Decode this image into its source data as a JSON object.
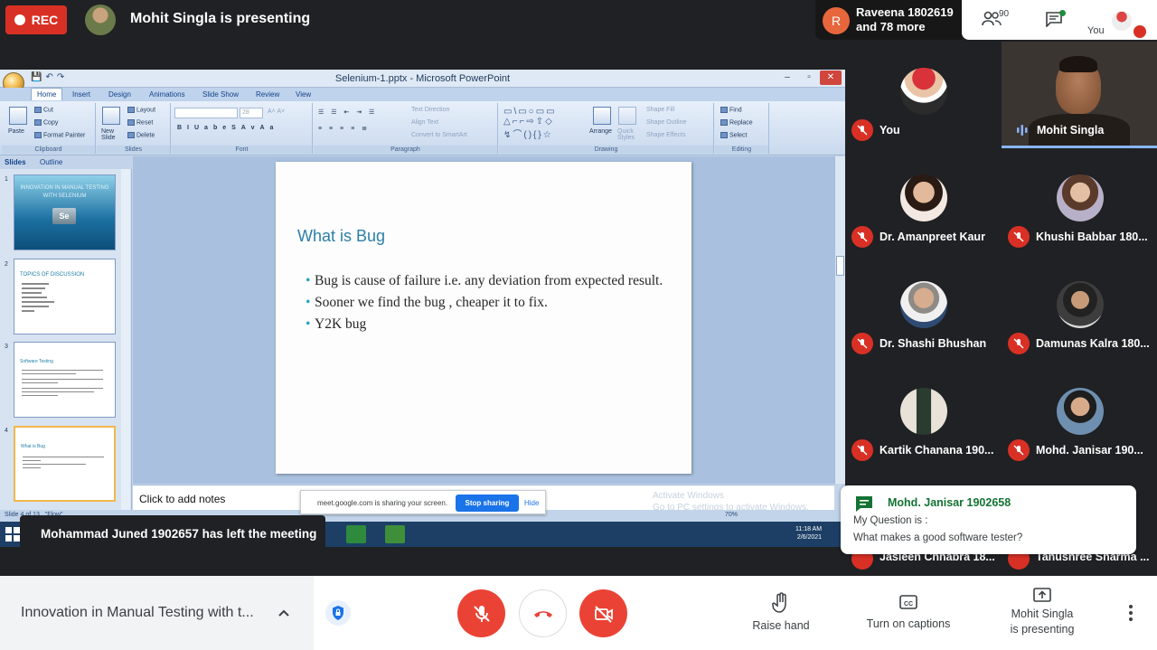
{
  "top": {
    "rec_label": "REC",
    "presenting_title": "Mohit Singla is presenting",
    "chip_avatar_letter": "R",
    "chip_line1": "Raveena 1802619",
    "chip_line2": "and 78 more",
    "people_count": "90",
    "you_label": "You"
  },
  "ppt": {
    "window_title": "Selenium-1.pptx - Microsoft PowerPoint",
    "tabs": [
      "Home",
      "Insert",
      "Design",
      "Animations",
      "Slide Show",
      "Review",
      "View"
    ],
    "ribbon": {
      "clipboard": {
        "label": "Clipboard",
        "paste": "Paste",
        "cut": "Cut",
        "copy": "Copy",
        "format_painter": "Format Painter"
      },
      "slides": {
        "label": "Slides",
        "new_slide": "New Slide",
        "layout": "Layout",
        "reset": "Reset",
        "delete": "Delete"
      },
      "font": {
        "label": "Font"
      },
      "paragraph": {
        "label": "Paragraph",
        "text_direction": "Text Direction",
        "align_text": "Align Text",
        "convert_smartart": "Convert to SmartArt"
      },
      "drawing": {
        "label": "Drawing",
        "arrange": "Arrange",
        "quick_styles": "Quick Styles",
        "shape_fill": "Shape Fill",
        "shape_outline": "Shape Outline",
        "shape_effects": "Shape Effects"
      },
      "editing": {
        "label": "Editing",
        "find": "Find",
        "replace": "Replace",
        "select": "Select"
      }
    },
    "pane_tabs": {
      "slides": "Slides",
      "outline": "Outline"
    },
    "thumbnails": [
      {
        "num": "1",
        "title": "INNOVATION IN MANUAL TESTING WITH SELENIUM",
        "logo": "Se"
      },
      {
        "num": "2",
        "title": "TOPICS OF DISCUSSION"
      },
      {
        "num": "3",
        "title": "Software Testing"
      },
      {
        "num": "4",
        "title": "What is Bug"
      }
    ],
    "slide": {
      "title": "What is Bug",
      "bullets": [
        "Bug is cause of failure i.e. any deviation from expected result.",
        "Sooner we find the bug , cheaper it to fix.",
        "Y2K bug"
      ]
    },
    "notes_placeholder": "Click to add notes",
    "activate_line1": "Activate Windows",
    "activate_line2": "Go to PC settings to activate Windows.",
    "status_slide": "Slide 4 of 13",
    "status_theme": "\"Flow\"",
    "zoom": "70%",
    "clock_time": "11:18 AM",
    "clock_date": "2/6/2021"
  },
  "sharing": {
    "message": "meet.google.com is sharing your screen.",
    "stop_label": "Stop sharing",
    "hide_label": "Hide"
  },
  "left_toast": "Mohammad Juned 1902657 has left the meeting",
  "participants": [
    {
      "name": "You"
    },
    {
      "name": "Mohit Singla"
    },
    {
      "name": "Dr. Amanpreet Kaur"
    },
    {
      "name": "Khushi Babbar 180..."
    },
    {
      "name": "Dr. Shashi Bhushan"
    },
    {
      "name": "Damunas Kalra 180..."
    },
    {
      "name": "Kartik Chanana 190..."
    },
    {
      "name": "Mohd. Janisar 190..."
    },
    {
      "name": "Jasleen Chhabra 18..."
    },
    {
      "name": "Tanushree Sharma ..."
    }
  ],
  "chat_toast": {
    "from": "Mohd. Janisar 1902658",
    "line1": "My Question is :",
    "line2": "What makes a good software tester?"
  },
  "bottom": {
    "meeting_title": "Innovation in Manual Testing with t...",
    "raise_hand": "Raise hand",
    "captions": "Turn on captions",
    "presenting_line1": "Mohit Singla",
    "presenting_line2": "is presenting"
  },
  "colors": {
    "meet_dark": "#202124",
    "red": "#ea4335",
    "blue": "#1a73e8",
    "chat_green": "#137333",
    "slide_title": "#2c7fa8"
  }
}
